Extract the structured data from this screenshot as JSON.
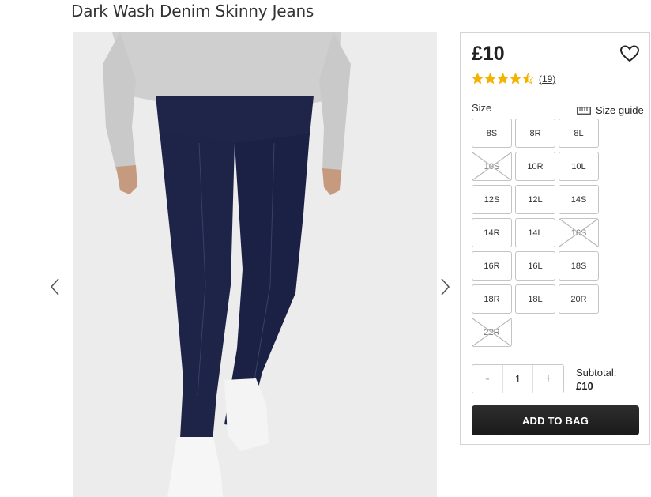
{
  "product": {
    "title": "Dark Wash Denim Skinny Jeans",
    "price": "£10",
    "rating": 4.5,
    "review_count": "19"
  },
  "gallery": {
    "prev_icon": "chevron-left-icon",
    "next_icon": "chevron-right-icon"
  },
  "size": {
    "label": "Size",
    "guide_label": "Size guide",
    "options": [
      {
        "label": "8S",
        "available": true
      },
      {
        "label": "8R",
        "available": true
      },
      {
        "label": "8L",
        "available": true
      },
      {
        "label": "10S",
        "available": false
      },
      {
        "label": "10R",
        "available": true
      },
      {
        "label": "10L",
        "available": true
      },
      {
        "label": "12S",
        "available": true
      },
      {
        "label": "12L",
        "available": true
      },
      {
        "label": "14S",
        "available": true
      },
      {
        "label": "14R",
        "available": true
      },
      {
        "label": "14L",
        "available": true
      },
      {
        "label": "16S",
        "available": false
      },
      {
        "label": "16R",
        "available": true
      },
      {
        "label": "16L",
        "available": true
      },
      {
        "label": "18S",
        "available": true
      },
      {
        "label": "18R",
        "available": true
      },
      {
        "label": "18L",
        "available": true
      },
      {
        "label": "20R",
        "available": true
      },
      {
        "label": "22R",
        "available": false
      }
    ]
  },
  "quantity": {
    "decrement": "-",
    "value": "1",
    "increment": "+"
  },
  "subtotal": {
    "label": "Subtotal:",
    "amount": "£10"
  },
  "cta": {
    "add_to_bag": "ADD TO BAG"
  },
  "colors": {
    "star": "#f5b301",
    "button": "#222222",
    "denim": "#1e2447",
    "sweater": "#cfcfcf"
  }
}
